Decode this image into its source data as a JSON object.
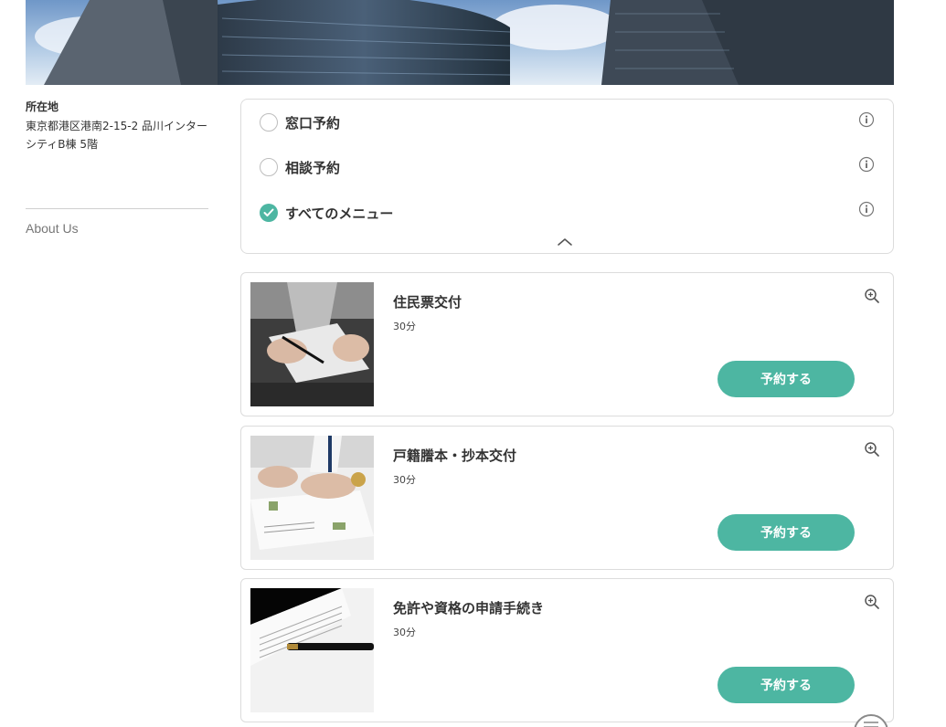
{
  "hero": {
    "image": "office-building-photo"
  },
  "sidebar": {
    "location_heading": "所在地",
    "address_line1": "東京都港区港南2-15-2 品川インター",
    "address_line2": "シティB棟 5階",
    "about_link": "About Us"
  },
  "filters": {
    "options": [
      {
        "label": "窓口予約",
        "checked": false
      },
      {
        "label": "相談予約",
        "checked": false
      },
      {
        "label": "すべてのメニュー",
        "checked": true
      }
    ],
    "info_icon": "info-icon",
    "collapse_icon": "chevron-up-icon"
  },
  "menu": {
    "items": [
      {
        "title": "住民票交付",
        "duration": "30分",
        "button": "予約する",
        "image": "signing-document-photo"
      },
      {
        "title": "戸籍謄本・抄本交付",
        "duration": "30分",
        "button": "予約する",
        "image": "hands-on-papers-photo"
      },
      {
        "title": "免許や資格の申請手続き",
        "duration": "30分",
        "button": "予約する",
        "image": "pen-on-document-photo"
      }
    ],
    "zoom_icon": "zoom-in-icon"
  },
  "colors": {
    "accent": "#4db6a2",
    "border": "#dcdcdc",
    "text": "#333333"
  }
}
